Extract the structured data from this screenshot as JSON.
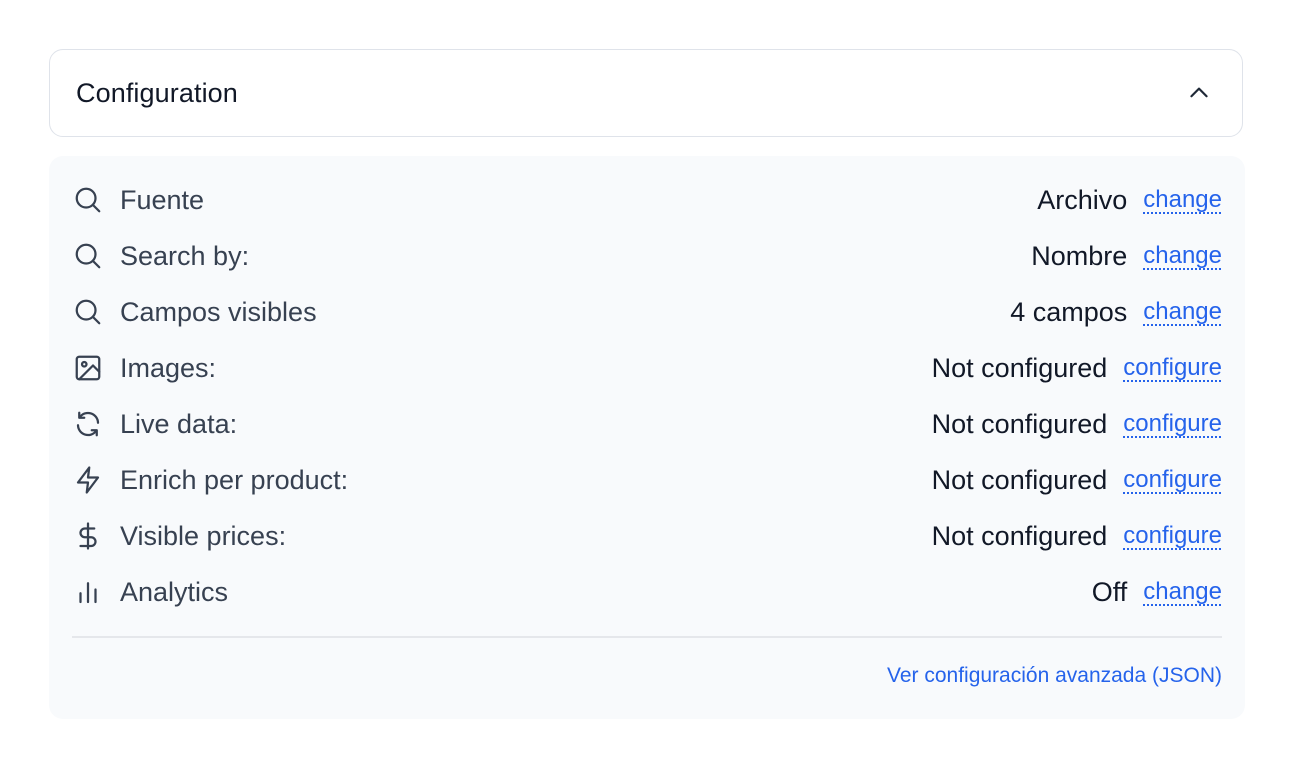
{
  "header": {
    "title": "Configuration",
    "toggle_icon": "chevron-up-icon"
  },
  "rows": [
    {
      "icon": "search-icon",
      "label": "Fuente",
      "value": "Archivo",
      "action": "change"
    },
    {
      "icon": "search-icon",
      "label": "Search by:",
      "value": "Nombre",
      "action": "change"
    },
    {
      "icon": "search-icon",
      "label": "Campos visibles",
      "value": "4 campos",
      "action": "change"
    },
    {
      "icon": "image-icon",
      "label": "Images:",
      "value": "Not configured",
      "action": "configure"
    },
    {
      "icon": "refresh-icon",
      "label": "Live data:",
      "value": "Not configured",
      "action": "configure"
    },
    {
      "icon": "lightning-icon",
      "label": "Enrich per product:",
      "value": "Not configured",
      "action": "configure"
    },
    {
      "icon": "dollar-icon",
      "label": "Visible prices:",
      "value": "Not configured",
      "action": "configure"
    },
    {
      "icon": "bar-chart-icon",
      "label": "Analytics",
      "value": "Off",
      "action": "change"
    }
  ],
  "footer": {
    "advanced_link": "Ver configuración avanzada (JSON)"
  },
  "colors": {
    "accent": "#2563eb",
    "text_primary": "#111827",
    "text_secondary": "#374151",
    "panel_bg": "#f8fafc",
    "border": "#dfe3ea"
  }
}
